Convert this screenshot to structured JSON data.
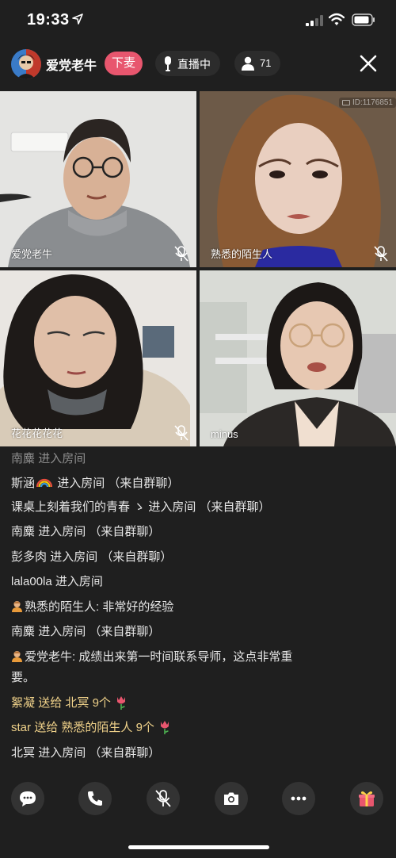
{
  "status_bar": {
    "time": "19:33",
    "icons": [
      "location-arrow-icon",
      "signal-icon",
      "wifi-icon",
      "battery-icon"
    ]
  },
  "header": {
    "host_name": "爱党老牛",
    "mic_off_label": "下麦",
    "live_label": "直播中",
    "viewer_count": "71",
    "accent_color": "#e8566e"
  },
  "tiles": [
    {
      "name": "爱党老牛",
      "muted": true
    },
    {
      "name": "熟悉的陌生人",
      "muted": true,
      "room_id": "ID:1176851"
    },
    {
      "name": "花花花花花",
      "muted": true
    },
    {
      "name": "minus",
      "muted": false
    }
  ],
  "chat": [
    {
      "user": "南麋",
      "text": "进入房间",
      "source": ""
    },
    {
      "user": "斯涵",
      "text": "进入房间",
      "source": "（来自群聊）"
    },
    {
      "user": "课桌上刻着我们的青春 ゝ",
      "text": "进入房间",
      "source": "（来自群聊）"
    },
    {
      "user": "南麋",
      "text": "进入房间",
      "source": "（来自群聊）"
    },
    {
      "user": "彭多肉",
      "text": "进入房间",
      "source": "（来自群聊）"
    },
    {
      "user": "lala00la",
      "text": "进入房间",
      "source": ""
    },
    {
      "user": "熟悉的陌生人:",
      "text": "非常好的经验",
      "source": ""
    },
    {
      "user": "南麋",
      "text": "进入房间",
      "source": "（来自群聊）"
    },
    {
      "user": "爱党老牛:",
      "text": "成绩出来第一时间联系导师，这点非常重",
      "source": ""
    },
    {
      "user": "",
      "text": "要。",
      "source": ""
    },
    {
      "user": "絮凝",
      "action": "送给",
      "recipient": "北冥",
      "text": "9个"
    },
    {
      "user": "star",
      "action": "送给",
      "recipient": "熟悉的陌生人",
      "text": "9个"
    },
    {
      "user": "北冥",
      "text": "进入房间",
      "source": "（来自群聊）"
    }
  ],
  "bottom_bar": {
    "buttons": [
      "chat-icon",
      "phone-icon",
      "mic-mute-icon",
      "camera-icon",
      "more-icon",
      "gift-icon"
    ]
  },
  "colors": {
    "background": "#1f1f1f",
    "gift_text": "#f0d28a"
  }
}
